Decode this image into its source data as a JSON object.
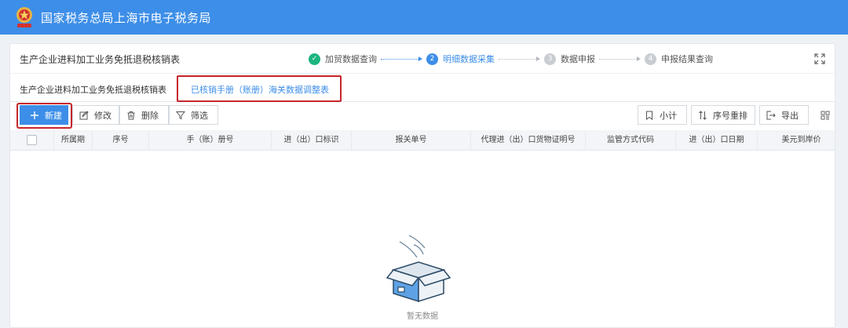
{
  "site": {
    "title": "国家税务总局上海市电子税务局",
    "emblem_icon": "tax-emblem-icon"
  },
  "page": {
    "title": "生产企业进料加工业务免抵退税核销表"
  },
  "steps": [
    {
      "number": "✓",
      "label": "加贸数据查询",
      "state": "done"
    },
    {
      "number": "2",
      "label": "明细数据采集",
      "state": "active"
    },
    {
      "number": "3",
      "label": "数据申报",
      "state": "pending"
    },
    {
      "number": "4",
      "label": "申报结果查询",
      "state": "pending"
    }
  ],
  "tabs": [
    {
      "label": "生产企业进料加工业务免抵退税核销表"
    },
    {
      "label": "已核销手册（账册）海关数据调整表"
    }
  ],
  "toolbar": {
    "new": "新建",
    "edit": "修改",
    "delete": "删除",
    "filter": "筛选",
    "subtotal": "小计",
    "reorder": "序号重排",
    "export": "导出"
  },
  "table": {
    "columns": [
      "所属期",
      "序号",
      "手（账）册号",
      "进（出）口标识",
      "报关单号",
      "代理进（出）口货物证明号",
      "监管方式代码",
      "进（出）口日期",
      "美元到岸价"
    ]
  },
  "empty": {
    "text": "暂无数据"
  },
  "colors": {
    "brand": "#3d8ee8",
    "highlight": "#c6252b",
    "done": "#1cb57f"
  }
}
